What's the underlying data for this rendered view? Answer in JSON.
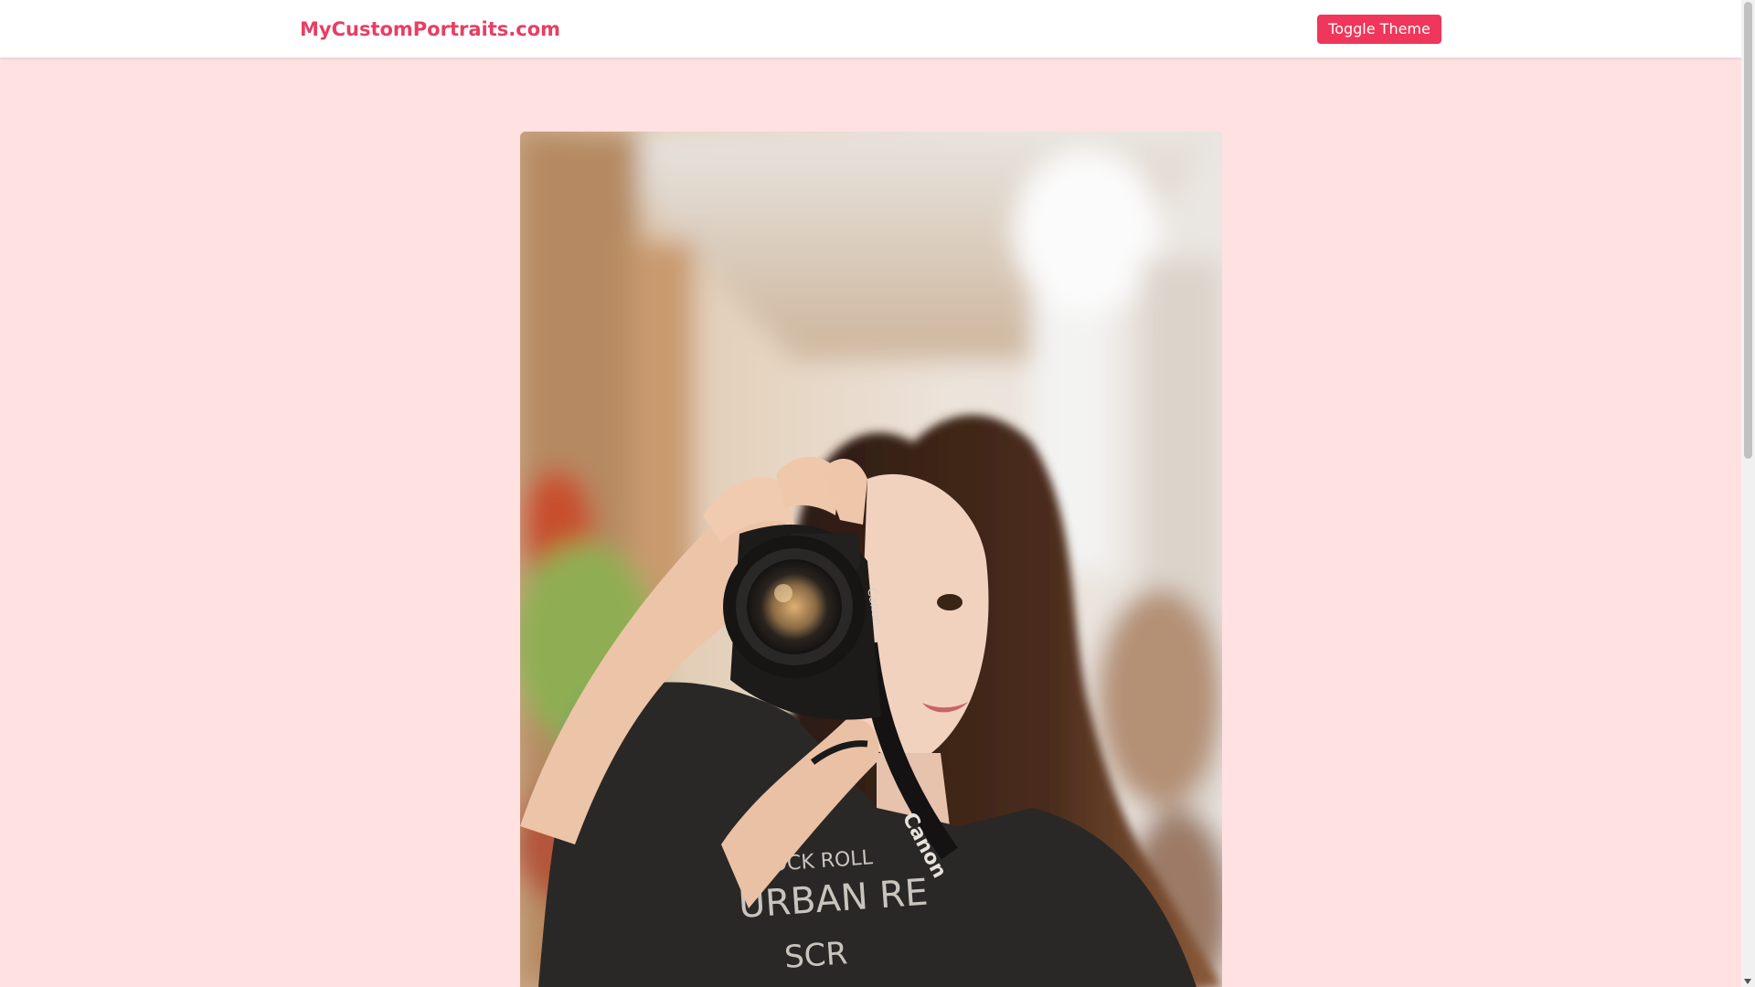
{
  "header": {
    "brand": "MyCustomPortraits.com",
    "toggle_theme_label": "Toggle Theme"
  },
  "main": {
    "hero_image_alt": "Woman holding a Canon camera in front of her face"
  },
  "colors": {
    "brand": "#e83e63",
    "button": "#f0365a",
    "page_background": "#ffe1e2",
    "navbar_background": "#ffffff"
  }
}
